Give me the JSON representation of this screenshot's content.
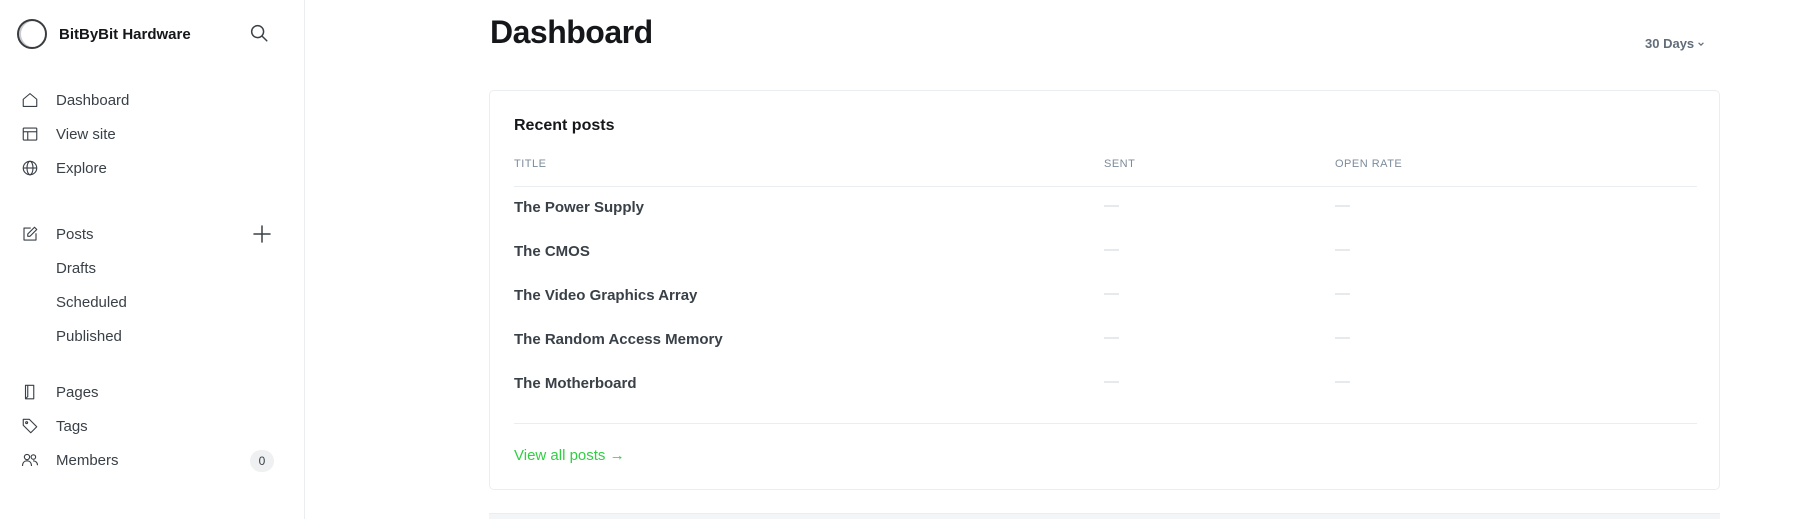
{
  "sidebar": {
    "site_name": "BitByBit Hardware",
    "primary": [
      {
        "label": "Dashboard",
        "icon": "home-icon"
      },
      {
        "label": "View site",
        "icon": "layout-icon"
      },
      {
        "label": "Explore",
        "icon": "globe-icon"
      }
    ],
    "posts": {
      "label": "Posts",
      "icon": "edit-icon",
      "sub": [
        "Drafts",
        "Scheduled",
        "Published"
      ]
    },
    "secondary": [
      {
        "label": "Pages",
        "icon": "page-icon"
      },
      {
        "label": "Tags",
        "icon": "tag-icon"
      },
      {
        "label": "Members",
        "icon": "members-icon",
        "count": "0"
      }
    ]
  },
  "header": {
    "title": "Dashboard",
    "range": "30 Days"
  },
  "recent_posts": {
    "title": "Recent posts",
    "columns": [
      "TITLE",
      "SENT",
      "OPEN RATE"
    ],
    "rows": [
      {
        "title": "The Power Supply",
        "sent": "—",
        "open_rate": "—"
      },
      {
        "title": "The CMOS",
        "sent": "—",
        "open_rate": "—"
      },
      {
        "title": "The Video Graphics Array",
        "sent": "—",
        "open_rate": "—"
      },
      {
        "title": "The Random Access Memory",
        "sent": "—",
        "open_rate": "—"
      },
      {
        "title": "The Motherboard",
        "sent": "—",
        "open_rate": "—"
      }
    ],
    "view_all": "View all posts →"
  },
  "colors": {
    "accent": "#30cf43",
    "text": "#15171a",
    "muted": "#7c8b9a",
    "border": "#ebeef0"
  }
}
